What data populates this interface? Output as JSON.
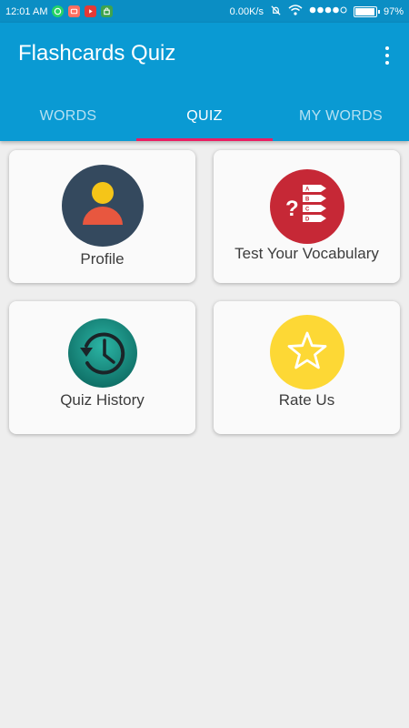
{
  "status_bar": {
    "time": "12:01 AM",
    "network_speed": "0.00K/s",
    "battery_percent": "97%",
    "battery_level": 0.97
  },
  "app_bar": {
    "title": "Flashcards Quiz"
  },
  "tabs": [
    {
      "label": "WORDS",
      "active": false
    },
    {
      "label": "QUIZ",
      "active": true
    },
    {
      "label": "MY WORDS",
      "active": false
    }
  ],
  "cards": {
    "profile": {
      "label": "Profile",
      "icon": "profile-icon"
    },
    "test": {
      "label": "Test Your Vocabulary",
      "icon": "quiz-options-icon"
    },
    "history": {
      "label": "Quiz History",
      "icon": "history-icon"
    },
    "rate": {
      "label": "Rate Us",
      "icon": "star-icon"
    }
  },
  "colors": {
    "primary": "#0a9ad3",
    "status_bar": "#0b8ec4",
    "tab_indicator": "#e91e63",
    "background": "#eeeeee"
  }
}
